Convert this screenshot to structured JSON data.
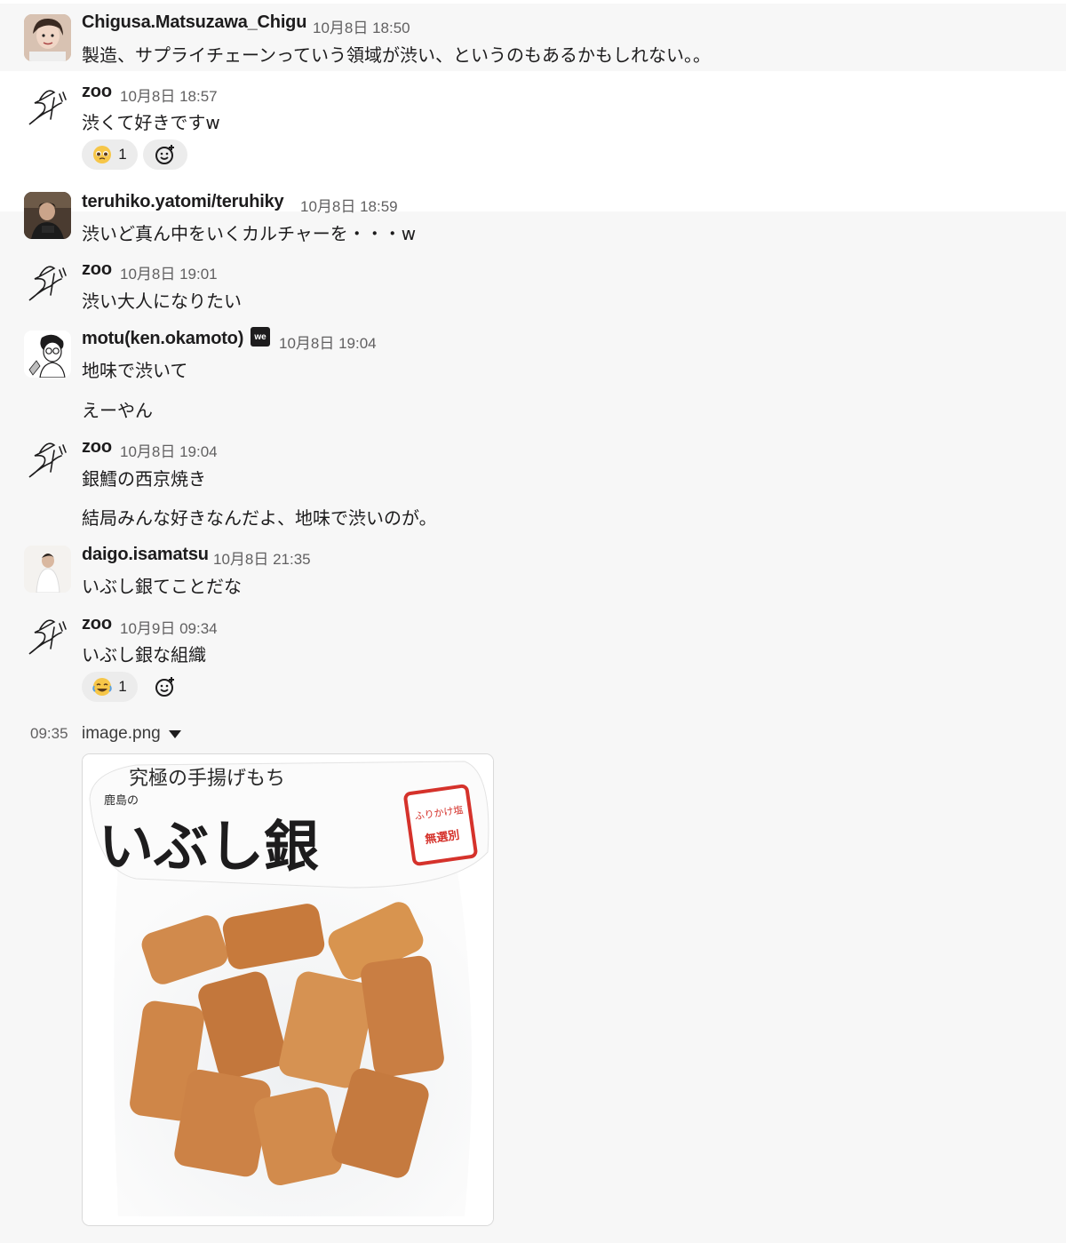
{
  "messages": [
    {
      "user": "Chigusa.Matsuzawa_Chigu",
      "time": "10月8日 18:50",
      "lines": [
        "製造、サプライチェーンっていう領域が渋い、というのもあるかもしれない。。"
      ]
    },
    {
      "user": "zoo",
      "time": "10月8日 18:57",
      "lines": [
        "渋くて好きですw"
      ],
      "reactions": [
        {
          "emoji": "pleading-face",
          "count": "1"
        }
      ]
    },
    {
      "user": "teruhiko.yatomi/teruhiky",
      "time": "10月8日 18:59",
      "lines": [
        "渋いど真ん中をいくカルチャーを・・・w"
      ]
    },
    {
      "user": "zoo",
      "time": "10月8日 19:01",
      "lines": [
        "渋い大人になりたい"
      ]
    },
    {
      "user": "motu(ken.okamoto)",
      "badge": "we",
      "time": "10月8日 19:04",
      "lines": [
        "地味で渋いて",
        "えーやん"
      ]
    },
    {
      "user": "zoo",
      "time": "10月8日 19:04",
      "lines": [
        "銀鱈の西京焼き",
        "結局みんな好きなんだよ、地味で渋いのが。"
      ]
    },
    {
      "user": "daigo.isamatsu",
      "time": "10月8日 21:35",
      "lines": [
        "いぶし銀てことだな"
      ]
    },
    {
      "user": "zoo",
      "time": "10月9日 09:34",
      "lines": [
        "いぶし銀な組織"
      ],
      "reactions": [
        {
          "emoji": "joy-face",
          "count": "1"
        }
      ]
    }
  ],
  "file": {
    "time": "09:35",
    "name": "image.png"
  },
  "product": {
    "top_label": "究極の手揚げもち",
    "origin": "鹿島の",
    "brand": "いぶし銀",
    "stamp_right": "ふりかけ塩",
    "stamp_left": "無選別"
  },
  "colors": {
    "accent_stamp": "#d5322b",
    "bg": "#f7f7f7",
    "text": "#1d1c1d",
    "muted": "#616061"
  }
}
